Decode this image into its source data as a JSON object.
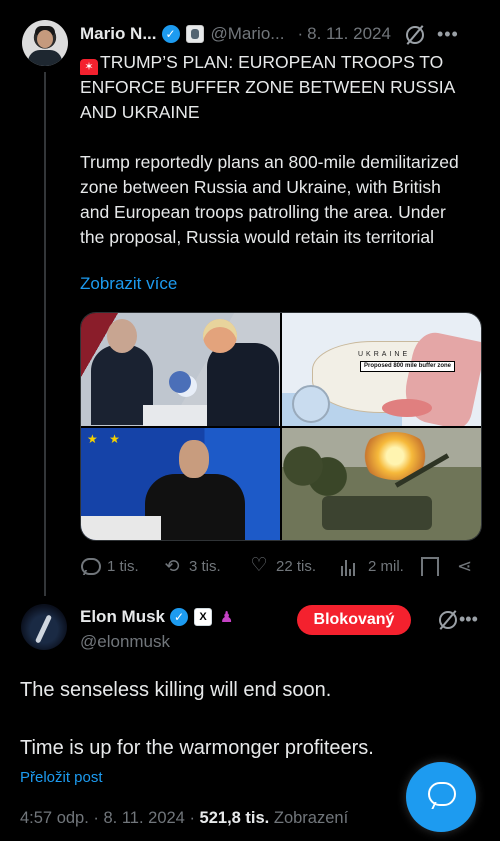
{
  "tweet1": {
    "author_name": "Mario N...",
    "handle": "@Mario...",
    "separator": "·",
    "date": "8. 11. 2024",
    "more": "•••",
    "alarm_icon": "🚨",
    "headline": "TRUMP’S PLAN: EUROPEAN TROOPS TO ENFORCE BUFFER ZONE BETWEEN RUSSIA AND UKRAINE",
    "body": "Trump reportedly plans an 800-mile demilitarized zone between Russia and Ukraine, with British and European troops patrolling the area. Under the proposal, Russia would retain its territorial",
    "show_more": "Zobrazit více",
    "map_label": "Proposed 800 mile buffer zone",
    "map_country": "UKRAINE",
    "actions": {
      "replies": "1 tis.",
      "reposts": "3 tis.",
      "likes": "22 tis.",
      "views": "2 mil."
    },
    "icons": {
      "verified": "check",
      "reply": "reply-icon",
      "repost": "⟲",
      "like": "♡",
      "share": "share-icon"
    }
  },
  "tweet2": {
    "author_name": "Elon Musk",
    "handle": "@elonmusk",
    "x_badge": "X",
    "gov_badge": "♟",
    "blocked_label": "Blokovaný",
    "more": "•••",
    "line1": "The senseless killing will end soon.",
    "line2": "Time is up for the warmonger profiteers.",
    "translate": "Přeložit post",
    "time": "4:57 odp.",
    "date": "8. 11. 2024",
    "views_count": "521,8 tis.",
    "views_label": "Zobrazení"
  },
  "colors": {
    "accent": "#1d9bf0",
    "blocked": "#f4212e",
    "muted": "#71767b",
    "text": "#e7e9ea"
  }
}
